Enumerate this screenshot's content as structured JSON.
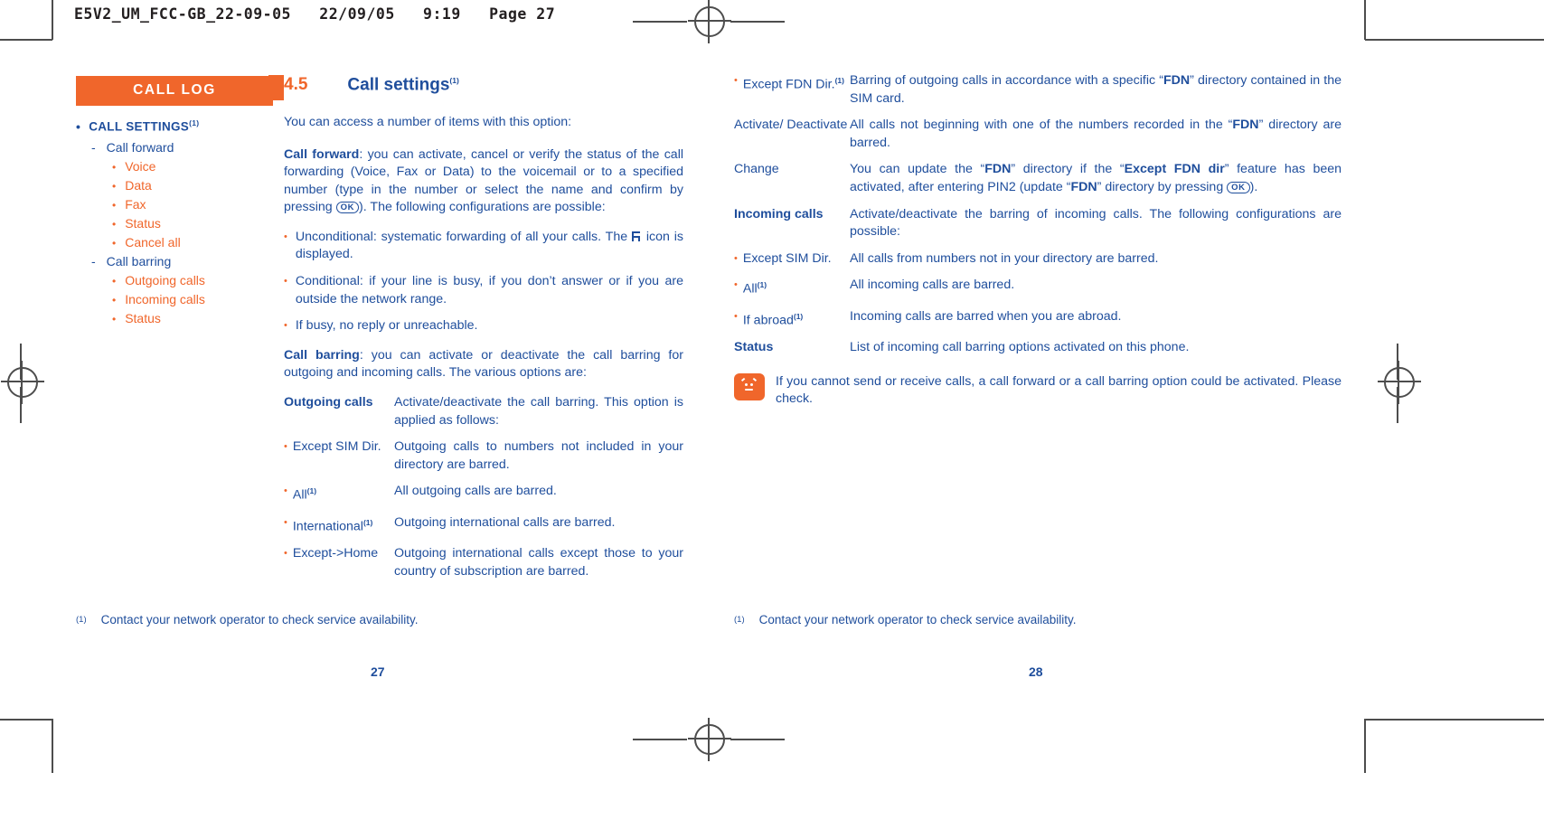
{
  "print_slug": "E5V2_UM_FCC-GB_22-09-05   22/09/05   9:19   Page 27",
  "colors": {
    "brand_orange": "#f0662b",
    "brand_navy": "#1f4e9c",
    "mark_gray": "#4d4d4d"
  },
  "sidebar": {
    "banner": "CALL LOG",
    "items": [
      {
        "level": 1,
        "label": "CALL SETTINGS",
        "sup": "(1)"
      },
      {
        "level": 2,
        "label": "Call forward"
      },
      {
        "level": 3,
        "label": "Voice"
      },
      {
        "level": 3,
        "label": "Data"
      },
      {
        "level": 3,
        "label": "Fax"
      },
      {
        "level": 3,
        "label": "Status"
      },
      {
        "level": 3,
        "label": "Cancel all"
      },
      {
        "level": 2,
        "label": "Call barring"
      },
      {
        "level": 3,
        "label": "Outgoing calls"
      },
      {
        "level": 3,
        "label": "Incoming calls"
      },
      {
        "level": 3,
        "label": "Status"
      }
    ]
  },
  "left_page": {
    "section_number": "4.5",
    "section_title": "Call settings",
    "section_sup": "(1)",
    "lead": "You can access a number of items with this option:",
    "call_forward_term": "Call forward",
    "call_forward_body_1": ": you can activate, cancel or verify the status of the call forwarding (Voice, Fax or Data) to the voicemail or to a specified number (type in the number or select the name and confirm by pressing",
    "ok_key": "OK",
    "call_forward_body_2": "). The following configurations are possible:",
    "forward_bullets": [
      {
        "text_before": "Unconditional: systematic forwarding of all your calls. The",
        "icon": "call-forward-icon",
        "text_after": "icon is displayed."
      },
      {
        "text_before": "Conditional: if your line is busy, if you don’t answer or if you are outside the network range.",
        "icon": "",
        "text_after": ""
      },
      {
        "text_before": "If busy, no reply or unreachable.",
        "icon": "",
        "text_after": ""
      }
    ],
    "call_barring_term": "Call barring",
    "call_barring_body": ": you can activate or deactivate the call barring for outgoing and incoming calls. The various options are:",
    "outgoing_rows": [
      {
        "bullet": false,
        "bold": true,
        "term": "Outgoing calls",
        "sup": "",
        "desc": "Activate/deactivate the call barring. This option is applied as follows:"
      },
      {
        "bullet": true,
        "bold": false,
        "term": "Except SIM Dir.",
        "sup": "",
        "desc": "Outgoing calls to numbers not included in your directory are barred."
      },
      {
        "bullet": true,
        "bold": false,
        "term": "All",
        "sup": "(1)",
        "desc": "All outgoing calls are barred."
      },
      {
        "bullet": true,
        "bold": false,
        "term": "International",
        "sup": "(1)",
        "desc": "Outgoing international calls are barred."
      },
      {
        "bullet": true,
        "bold": false,
        "term": "Except->Home",
        "sup": "",
        "desc": "Outgoing international calls except those to your country of subscription are barred."
      }
    ],
    "footnote_mark": "(1)",
    "footnote_text": "Contact your network operator to check service availability.",
    "folio": "27"
  },
  "right_page": {
    "fdn_rows": [
      {
        "bullet": true,
        "bold": false,
        "term": "Except FDN Dir.",
        "sup": "(1)",
        "desc_parts": [
          "Barring of outgoing calls in accordance with a specific “",
          "FDN",
          "” directory contained in the SIM card."
        ]
      },
      {
        "bullet": false,
        "bold": false,
        "term": "Activate/ Deactivate",
        "sup": "",
        "desc_parts": [
          "All calls not beginning with one of the numbers recorded in the “",
          "FDN",
          "” directory are barred."
        ]
      },
      {
        "bullet": false,
        "bold": false,
        "term": "Change",
        "sup": "",
        "desc_parts": [
          "You can update the “",
          "FDN",
          "” directory if the “",
          "Except FDN dir",
          "” feature has been activated, after entering PIN2 (update “",
          "FDN",
          "” directory by pressing ",
          "OK",
          ")."
        ]
      }
    ],
    "incoming_rows": [
      {
        "bullet": false,
        "bold": true,
        "term": "Incoming calls",
        "sup": "",
        "desc": "Activate/deactivate the barring of incoming calls. The following configurations are possible:"
      },
      {
        "bullet": true,
        "bold": false,
        "term": "Except SIM Dir.",
        "sup": "",
        "desc": "All calls from numbers not in your directory are barred."
      },
      {
        "bullet": true,
        "bold": false,
        "term": "All",
        "sup": "(1)",
        "desc": "All incoming calls are barred."
      },
      {
        "bullet": true,
        "bold": false,
        "term": "If abroad",
        "sup": "(1)",
        "desc": "Incoming calls are barred when you are abroad."
      },
      {
        "bullet": false,
        "bold": true,
        "term": "Status",
        "sup": "",
        "desc": "List of incoming call barring options activated on this phone."
      }
    ],
    "note_text": "If you cannot send or receive calls, a call forward or a call barring option could be activated. Please check.",
    "footnote_mark": "(1)",
    "footnote_text": "Contact your network operator to check service availability.",
    "folio": "28"
  }
}
